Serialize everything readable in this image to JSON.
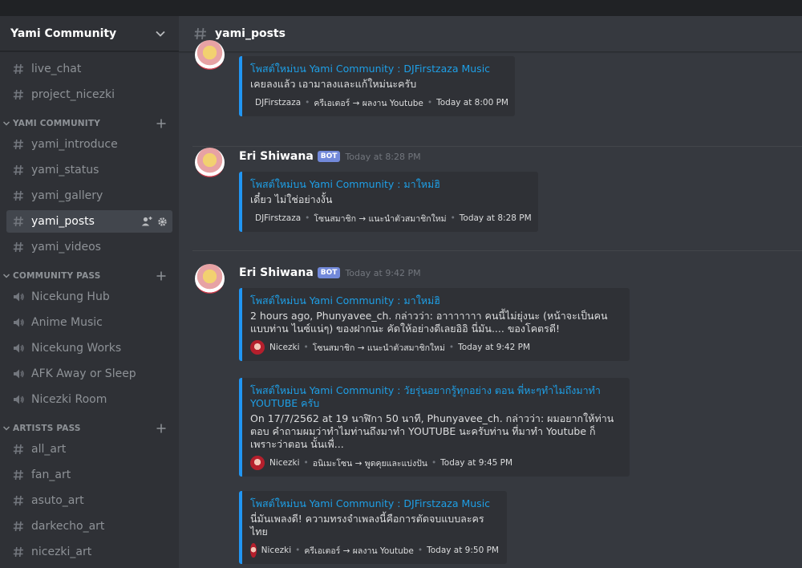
{
  "guild": {
    "name": "Yami Community"
  },
  "sidebar": {
    "top_channels": [
      {
        "label": "live_chat",
        "type": "text"
      },
      {
        "label": "project_nicezki",
        "type": "text"
      }
    ],
    "categories": [
      {
        "label": "YAMI COMMUNITY",
        "channels": [
          {
            "label": "yami_introduce",
            "type": "text"
          },
          {
            "label": "yami_status",
            "type": "text"
          },
          {
            "label": "yami_gallery",
            "type": "text"
          },
          {
            "label": "yami_posts",
            "type": "text",
            "active": true
          },
          {
            "label": "yami_videos",
            "type": "text"
          }
        ]
      },
      {
        "label": "COMMUNITY PASS",
        "channels": [
          {
            "label": "Nicekung Hub",
            "type": "voice"
          },
          {
            "label": "Anime Music",
            "type": "voice"
          },
          {
            "label": "Nicekung Works",
            "type": "voice"
          },
          {
            "label": "AFK Away or Sleep",
            "type": "voice"
          },
          {
            "label": "Nicezki Room",
            "type": "voice"
          }
        ]
      },
      {
        "label": "ARTISTS PASS",
        "channels": [
          {
            "label": "all_art",
            "type": "text"
          },
          {
            "label": "fan_art",
            "type": "text"
          },
          {
            "label": "asuto_art",
            "type": "text"
          },
          {
            "label": "darkecho_art",
            "type": "text"
          },
          {
            "label": "nicezki_art",
            "type": "text"
          }
        ]
      }
    ]
  },
  "channel_header": {
    "title": "yami_posts"
  },
  "messages": [
    {
      "embeds": [
        {
          "title": "โพสต์ใหม่บน Yami Community : DJFirstzaza Music",
          "description": "เคยลงแล้ว เอามาลงและแก้ใหม่นะครับ",
          "footer_author": "DJFirstzaza",
          "footer_path": "ครีเอเตอร์ → ผลงาน Youtube",
          "footer_time": "Today at 8:00 PM",
          "avatar": "pink"
        }
      ]
    },
    {
      "author": "Eri Shiwana",
      "bot_tag": "BOT",
      "time": "Today at 8:28 PM",
      "embeds": [
        {
          "title": "โพสต์ใหม่บน Yami Community : มาใหม่ฮิ",
          "description": "เดี๋ยว ไม่ใช่อย่างงั้น",
          "footer_author": "DJFirstzaza",
          "footer_path": "โซนสมาชิก → แนะนำตัวสมาชิกใหม่",
          "footer_time": "Today at 8:28 PM",
          "avatar": "pink"
        }
      ]
    },
    {
      "author": "Eri Shiwana",
      "bot_tag": "BOT",
      "time": "Today at 9:42 PM",
      "embeds": [
        {
          "title": "โพสต์ใหม่บน Yami Community : มาใหม่ฮิ",
          "description": "2 hours ago, Phunyavee_ch. กล่าวว่า: อาาาาาาา คนนี้ไม่ยุ่งนะ (หน้าจะเป็นคนแบบท่าน ไนซ์แน่ๆ) ของฝากนะ คัดให้อย่างดีเลยอิอิ นี่มัน.... ของโคตรดี!",
          "footer_author": "Nicezki",
          "footer_path": "โซนสมาชิก → แนะนำตัวสมาชิกใหม่",
          "footer_time": "Today at 9:42 PM",
          "avatar": "red"
        },
        {
          "title": "โพสต์ใหม่บน Yami Community : วัยรุ่นอยากรู้ทุกอย่าง ตอน พี่หะๆทำไมถึงมาทำ YOUTUBE ครับ",
          "description": "On 17/7/2562 at 19 นาฬิกา 50 นาที, Phunyavee_ch. กล่าวว่า: ผมอยากให้ท่านตอบ คำถามผมว่าทำไมท่านถึงมาทำ YOUTUBE นะครับท่าน ที่มาทำ Youtube ก็เพราะว่าตอน นั้นเพื่...",
          "footer_author": "Nicezki",
          "footer_path": "อนิเมะโซน → พูดคุยและแบ่งปัน",
          "footer_time": "Today at 9:45 PM",
          "avatar": "red"
        },
        {
          "title": "โพสต์ใหม่บน Yami Community : DJFirstzaza Music",
          "description": "นี่มันเพลงดี! ความทรงจำเพลงนี้คือการตัดจบแบบละครไทย",
          "footer_author": "Nicezki",
          "footer_path": "ครีเอเตอร์ → ผลงาน Youtube",
          "footer_time": "Today at 9:50 PM",
          "avatar": "red"
        }
      ]
    }
  ],
  "colors": {
    "accent_blue": "#2196f3",
    "link_blue": "#1e9fe6",
    "bot_tag": "#7289da",
    "sidebar_bg": "#2f3136",
    "main_bg": "#36393f"
  },
  "icons": {
    "text_channel": "hash-icon",
    "voice_channel": "speaker-icon",
    "add_member": "add-member-icon",
    "settings": "gear-icon",
    "chevron": "chevron-down-icon",
    "add_channel": "plus-icon"
  }
}
